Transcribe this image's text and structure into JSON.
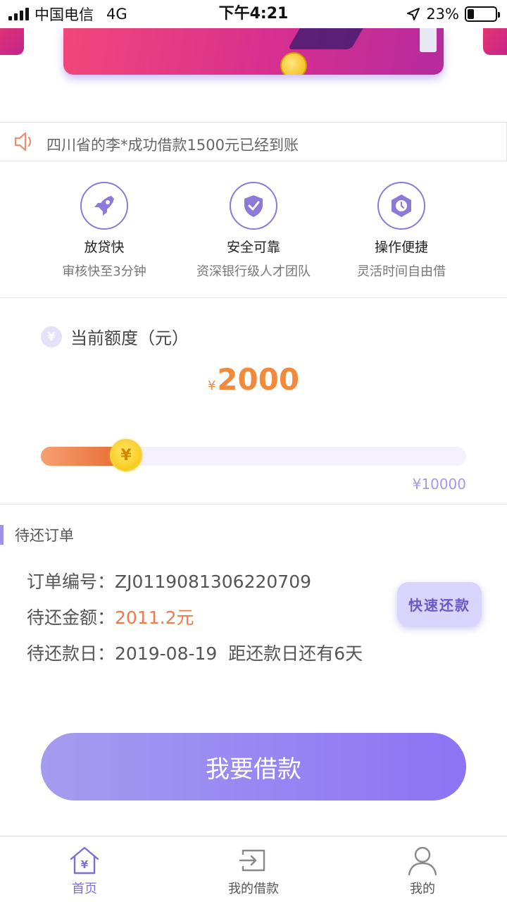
{
  "status_bar": {
    "carrier": "中国电信",
    "network": "4G",
    "time": "下午4:21",
    "battery": "23%",
    "battery_level": 0.23
  },
  "notice": {
    "text": "四川省的李*成功借款1500元已经到账"
  },
  "features": [
    {
      "title": "放贷快",
      "subtitle": "审核快至3分钟",
      "icon": "rocket-icon"
    },
    {
      "title": "安全可靠",
      "subtitle": "资深银行级人才团队",
      "icon": "shield-check-icon"
    },
    {
      "title": "操作便捷",
      "subtitle": "灵活时间自由借",
      "icon": "clock-icon"
    }
  ],
  "credit": {
    "label": "当前额度（元）",
    "currency": "¥",
    "amount": "2000",
    "max_label": "¥10000",
    "slider_fraction": 0.2,
    "knob_symbol": "¥"
  },
  "orders": {
    "section_title": "待还订单",
    "order_no_label": "订单编号：",
    "order_no": "ZJ0119081306220709",
    "amount_label": "待还金额：",
    "amount": "2011.2元",
    "due_label": "待还款日：",
    "due_date": "2019-08-19",
    "due_note": "距还款日还有6天",
    "quick_repay": "快速还款"
  },
  "borrow_button": "我要借款",
  "tabbar": {
    "items": [
      {
        "label": "首页",
        "icon": "home-icon",
        "active": true
      },
      {
        "label": "我的借款",
        "icon": "loan-icon",
        "active": false
      },
      {
        "label": "我的",
        "icon": "user-icon",
        "active": false
      }
    ]
  },
  "colors": {
    "accent_purple": "#8c73f5",
    "accent_orange": "#f28a3b",
    "banner_pink": "#e2356f"
  }
}
